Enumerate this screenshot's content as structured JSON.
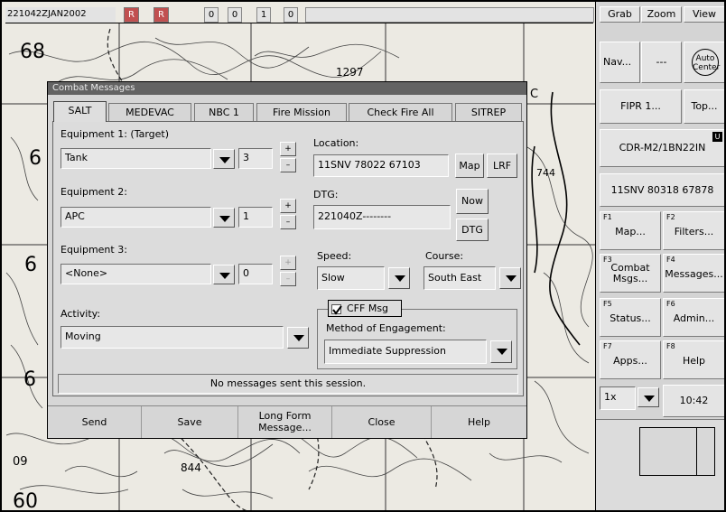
{
  "topbar": {
    "dtg": "221042ZJAN2002",
    "r1": "R",
    "r2": "R",
    "counters": [
      "0",
      "0",
      "1",
      "0"
    ]
  },
  "map": {
    "labels": [
      "68",
      "1297",
      "6",
      "6",
      "6",
      "744",
      "09",
      "844",
      "60",
      "C"
    ]
  },
  "right_panel": {
    "grab": "Grab",
    "zoom": "Zoom",
    "view": "View",
    "nav": "Nav...",
    "dashes": "---",
    "auto_center": "Auto Center",
    "fipr": "FIPR 1...",
    "top": "Top...",
    "unit_id": "CDR-M2/1BN22IN",
    "unit_badge": "U",
    "grid_ref": "11SNV 80318 67878",
    "f1_key": "F1",
    "f1_label": "Map...",
    "f2_key": "F2",
    "f2_label": "Filters...",
    "f3_key": "F3",
    "f3_label": "Combat Msgs...",
    "f4_key": "F4",
    "f4_label": "Messages...",
    "f5_key": "F5",
    "f5_label": "Status...",
    "f6_key": "F6",
    "f6_label": "Admin...",
    "f7_key": "F7",
    "f7_label": "Apps...",
    "f8_key": "F8",
    "f8_label": "Help",
    "zoom_level": "1x",
    "clock": "10:42"
  },
  "dialog": {
    "title": "Combat Messages",
    "tabs": [
      "SALT",
      "MEDEVAC",
      "NBC 1",
      "Fire Mission",
      "Check Fire All",
      "SITREP"
    ],
    "equipment1_label": "Equipment 1:  (Target)",
    "equipment1_value": "Tank",
    "equipment1_count": "3",
    "equipment2_label": "Equipment 2:",
    "equipment2_value": "APC",
    "equipment2_count": "1",
    "equipment3_label": "Equipment 3:",
    "equipment3_value": "<None>",
    "equipment3_count": "0",
    "location_label": "Location:",
    "location_value": "11SNV 78022 67103",
    "map_button": "Map",
    "lrf_button": "LRF",
    "dtg_label": "DTG:",
    "dtg_value": "221040Z--------",
    "now_button": "Now",
    "dtg_button": "DTG",
    "speed_label": "Speed:",
    "speed_value": "Slow",
    "course_label": "Course:",
    "course_value": "South East",
    "activity_label": "Activity:",
    "activity_value": "Moving",
    "cff_label": "CFF Msg",
    "method_label": "Method of Engagement:",
    "method_value": "Immediate Suppression",
    "status_message": "No messages sent this session.",
    "buttons": [
      "Send",
      "Save",
      "Long Form Message...",
      "Close",
      "Help"
    ],
    "plus": "+",
    "minus": "–"
  }
}
